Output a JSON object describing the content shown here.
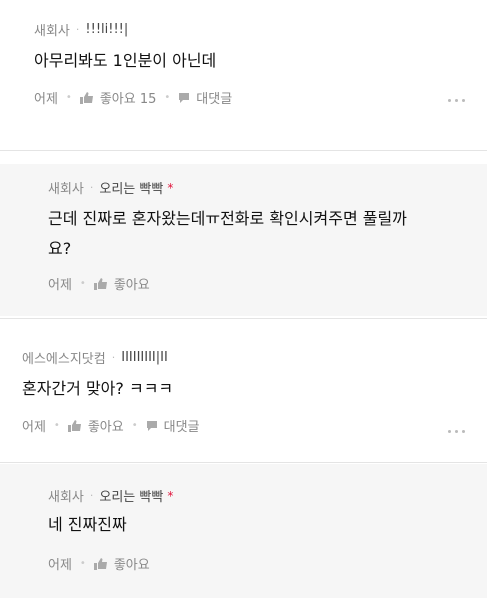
{
  "comments": [
    {
      "author": "새회사",
      "nickname": "!!!li!!!|",
      "text": "아무리봐도 1인분이 아닌데",
      "time": "어제",
      "like_label": "좋아요 15",
      "reply_label": "대댓글"
    },
    {
      "author": "새회사",
      "nickname": "오리는 빡빡",
      "star": "*",
      "text_line1": "근데 진짜로 혼자왔는데ㅠ전화로 확인시켜주면 풀릴까",
      "text_line2": "요?",
      "time": "어제",
      "like_label": "좋아요"
    },
    {
      "author": "에스에스지닷컴",
      "nickname": "IIIIIIIII|II",
      "text": "혼자간거 맞아? ㅋㅋㅋ",
      "time": "어제",
      "like_label": "좋아요",
      "reply_label": "대댓글"
    },
    {
      "author": "새회사",
      "nickname": "오리는 빡빡",
      "star": "*",
      "text": "네 진짜진짜",
      "time": "어제",
      "like_label": "좋아요"
    }
  ],
  "icons": {
    "like": "thumbs-up-icon",
    "reply": "speech-bubble-icon",
    "more": "more-dots-icon"
  },
  "colors": {
    "star": "#e0143c",
    "reply_bg": "#f6f6f6"
  }
}
